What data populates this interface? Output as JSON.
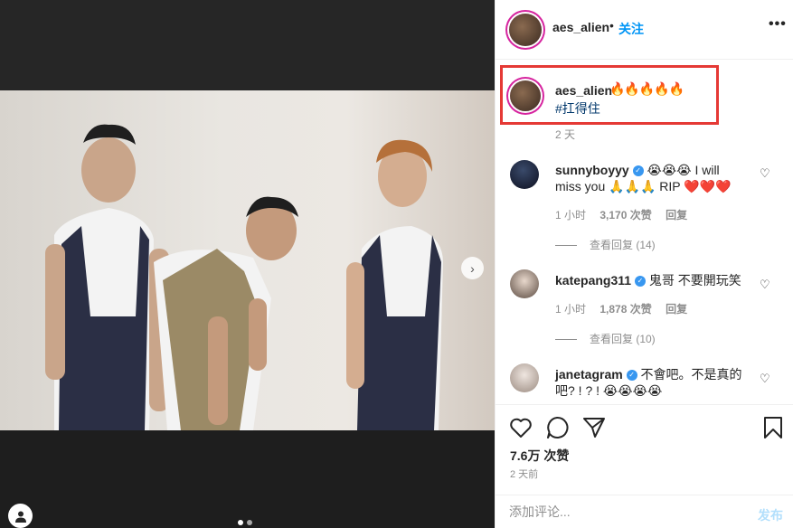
{
  "post": {
    "username": "aes_alien",
    "follow_label": "关注",
    "more_icon": "more-horizontal-icon"
  },
  "caption": {
    "username": "aes_alien",
    "emojis": "🔥🔥🔥🔥🔥",
    "hashtag": "#扛得住",
    "time": "2 天"
  },
  "comments": [
    {
      "username": "sunnyboyyy",
      "verified": true,
      "text": "😭😭😭 I will miss you 🙏🙏🙏 RIP ❤️❤️❤️",
      "time": "1 小时",
      "likes": "3,170 次赞",
      "reply_label": "回复",
      "view_replies": "查看回复 (14)"
    },
    {
      "username": "katepang311",
      "verified": true,
      "text": "鬼哥 不要開玩笑",
      "time": "1 小时",
      "likes": "1,878 次赞",
      "reply_label": "回复",
      "view_replies": "查看回复 (10)"
    },
    {
      "username": "janetagram",
      "verified": true,
      "text": "不會吧。不是真的吧? ! ? ! 😭😭😭😭",
      "time": "",
      "likes": "",
      "reply_label": "",
      "view_replies": ""
    }
  ],
  "stats": {
    "likes": "7.6万 次赞",
    "posted": "2 天前"
  },
  "composer": {
    "placeholder": "添加评论...",
    "post_label": "发布"
  },
  "carousel": {
    "slide_count": 2,
    "active_slide": 1
  }
}
